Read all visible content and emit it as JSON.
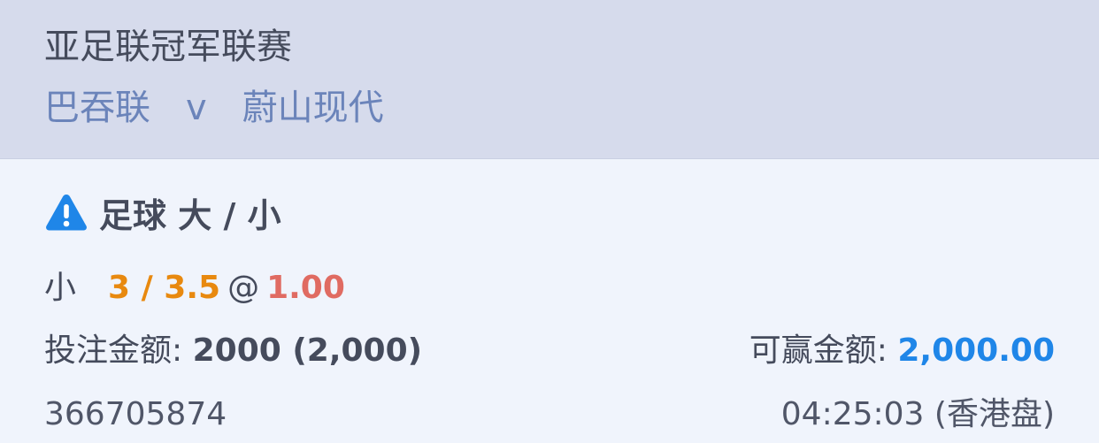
{
  "header": {
    "league": "亚足联冠军联赛",
    "home_team": "巴吞联",
    "vs": "v",
    "away_team": "蔚山现代"
  },
  "bet": {
    "type_label": "足球 大 / 小",
    "selection": "小",
    "handicap": "3 / 3.5",
    "at": "@",
    "odds": "1.00",
    "stake_label": "投注金额:",
    "stake_value": "2000 (2,000)",
    "win_label": "可赢金额:",
    "win_value": "2,000.00",
    "ticket_id": "366705874",
    "time": "04:25:03 (香港盘)"
  },
  "icons": {
    "warning": "warning-triangle-icon"
  },
  "colors": {
    "header_bg": "#d6dbec",
    "content_bg": "#f0f4fc",
    "team_text": "#6b84ba",
    "handicap": "#e8890f",
    "odds": "#e06b62",
    "win_amount": "#1f86e8",
    "warning_icon": "#1f86e8"
  }
}
